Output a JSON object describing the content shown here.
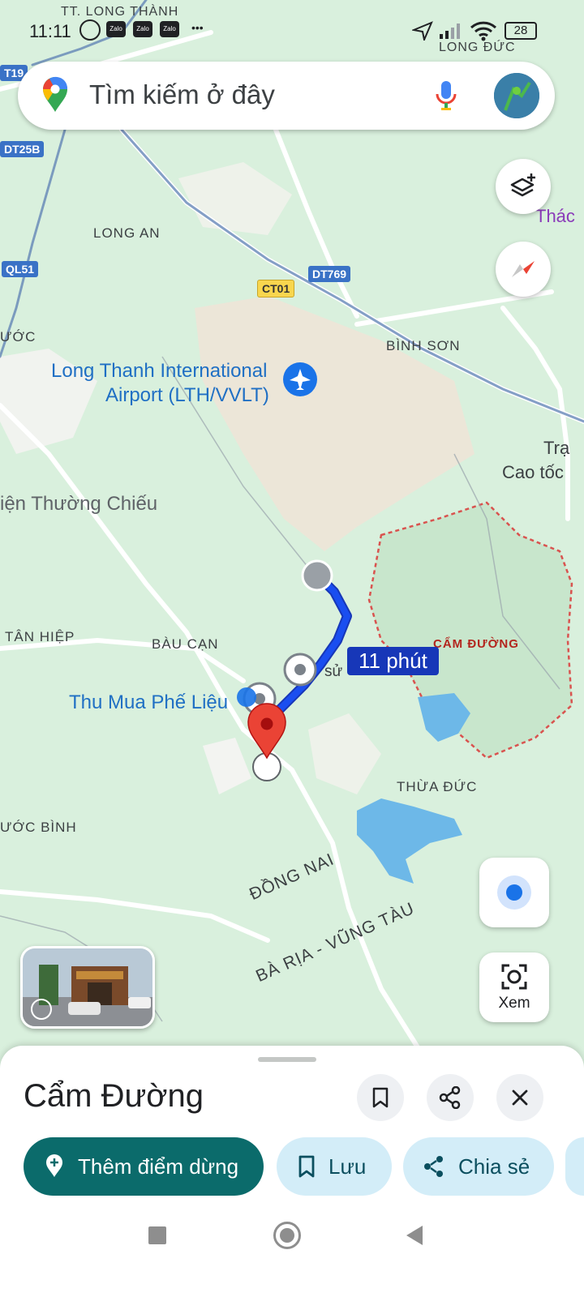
{
  "status_bar": {
    "time": "11:11",
    "apps": [
      "Zalo",
      "Zalo",
      "Zalo"
    ],
    "more": "•••",
    "battery": "28",
    "location_label": "LONG ĐỨC",
    "top_label": "TT. LONG THÀNH"
  },
  "search": {
    "placeholder": "Tìm kiếm ở đây",
    "icons": [
      "google-maps-pin-icon",
      "microphone-icon",
      "avatar"
    ]
  },
  "map": {
    "places": {
      "long_an": "LONG AN",
      "binh_son": "BÌNH SƠN",
      "tan_hiep": "TÂN HIỆP",
      "bau_can": "BÀU CẠN",
      "thua_duc": "THỪA ĐỨC",
      "cam_duong": "CẨM ĐƯỜNG",
      "phuoc_left": "ƯỚC",
      "phuoc_binh": "ƯỚC BÌNH",
      "dong_nai": "ĐỒNG NAI",
      "ba_ria": "BÀ RỊA - VŨNG TÀU",
      "thac": "Thác",
      "tra": "Trạ",
      "cao_toc": "Cao tốc",
      "su": "sử"
    },
    "pois": {
      "airport_line1": "Long Thanh International",
      "airport_line2": "Airport (LTH/VVLT)",
      "thuong_chieu": "iện Thường Chiếu",
      "thu_mua": "Thu Mua Phế Liệu"
    },
    "roads": [
      "T19",
      "DT25B",
      "QL51",
      "CT01",
      "DT769"
    ],
    "route_duration": "11 phút",
    "route_color": "#1a4ef0",
    "boundary_color": "#d9534f"
  },
  "controls": {
    "layers_icon": "layers-icon",
    "compass_icon": "compass-icon",
    "my_location_icon": "my-location-icon",
    "lens_label": "Xem"
  },
  "sheet": {
    "title": "Cẩm Đường",
    "chips": {
      "add_stop": "Thêm điểm dừng",
      "save": "Lưu",
      "share": "Chia sẻ"
    },
    "accent": "#0b6b6b"
  }
}
